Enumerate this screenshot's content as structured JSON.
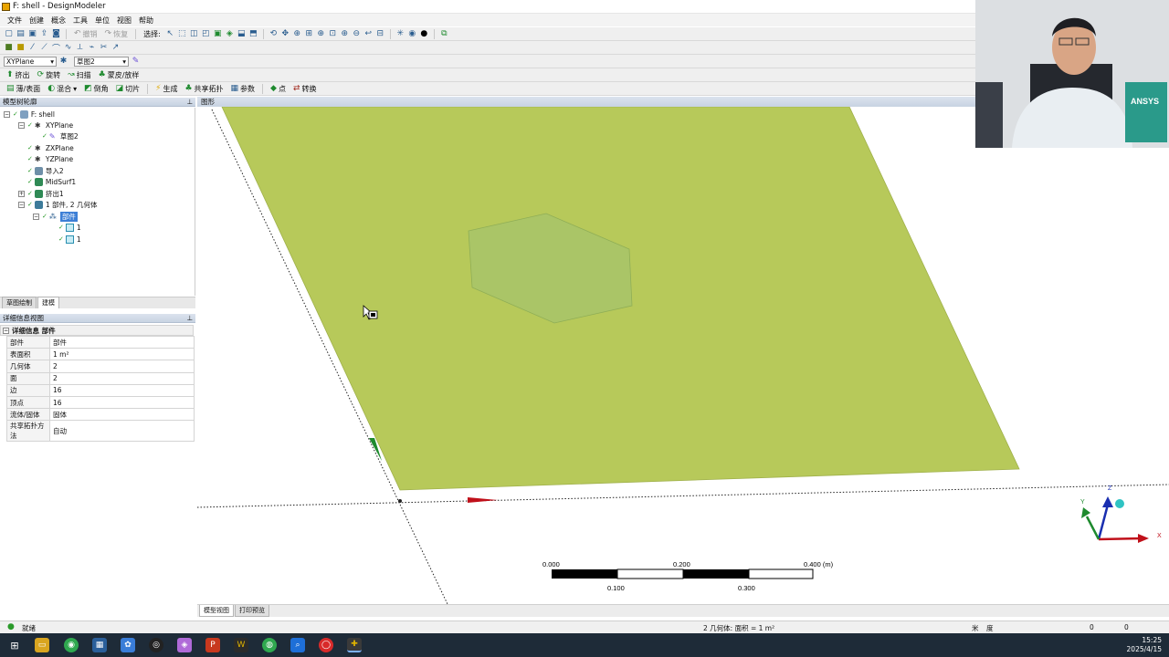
{
  "window": {
    "title": "F: shell - DesignModeler"
  },
  "menu": [
    "文件",
    "创建",
    "概念",
    "工具",
    "单位",
    "视图",
    "帮助"
  ],
  "toolbar1": {
    "undo": "撤销",
    "redo": "恢复",
    "select_label": "选择:"
  },
  "toolbar3": {
    "plane": "XYPlane",
    "sketch": "草图2"
  },
  "toolbar4": [
    "挤出",
    "旋转",
    "扫描",
    "蒙皮/放样"
  ],
  "toolbar5": [
    "薄/表面",
    "混合",
    "倒角",
    "切片",
    "生成",
    "共享拓扑",
    "参数",
    "点",
    "转换"
  ],
  "tree": {
    "header": "模型树轮廓",
    "items": [
      {
        "label": "F: shell"
      },
      {
        "label": "XYPlane"
      },
      {
        "label": "草图2"
      },
      {
        "label": "ZXPlane"
      },
      {
        "label": "YZPlane"
      },
      {
        "label": "导入2"
      },
      {
        "label": "MidSurf1"
      },
      {
        "label": "挤出1"
      },
      {
        "label": "1 部件, 2 几何体"
      },
      {
        "label": "部件"
      },
      {
        "label": "1"
      },
      {
        "label": "1"
      }
    ]
  },
  "left_tabs": [
    "草图绘制",
    "建模"
  ],
  "details": {
    "header": "详细信息视图",
    "section": "详细信息 部件",
    "rows": [
      {
        "k": "部件",
        "v": "部件"
      },
      {
        "k": "表面积",
        "v": "1 m²"
      },
      {
        "k": "几何体",
        "v": "2"
      },
      {
        "k": "面",
        "v": "2"
      },
      {
        "k": "边",
        "v": "16"
      },
      {
        "k": "顶点",
        "v": "16"
      },
      {
        "k": "流体/固体",
        "v": "固体"
      },
      {
        "k": "共享拓扑方法",
        "v": "自动"
      }
    ]
  },
  "viewport": {
    "header": "图形",
    "scale": {
      "t0": "0.000",
      "t1": "0.100",
      "t2": "0.200",
      "t3": "0.300",
      "t4": "0.400 (m)"
    },
    "triad": {
      "z": "Z",
      "y": "Y",
      "x": "X"
    },
    "colors": {
      "plate": "#b7c95a",
      "hexagon": "#a9c468"
    }
  },
  "bottom_tabs": [
    "模型视图",
    "打印预览"
  ],
  "status": {
    "ready": "就绪",
    "selection": "2 几何体: 面积 = 1 m²",
    "unit": "米",
    "angle": "度",
    "v1": "0",
    "v2": "0"
  },
  "clock": {
    "time": "15:25",
    "date": "2025/4/15"
  },
  "webcam": {
    "book_text": "ANSYS"
  }
}
